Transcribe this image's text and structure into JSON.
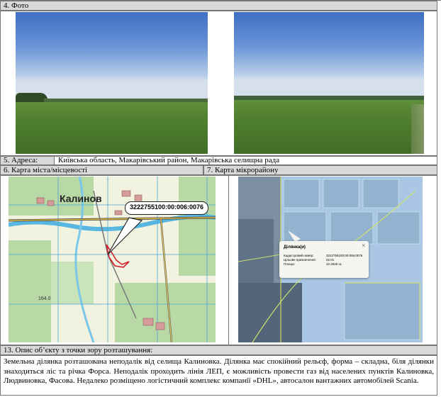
{
  "sections": {
    "photo_header": "4. Фото",
    "address_label": "5. Адреса:",
    "address_value": "Київська область, Макарівський район, Макарівська селищна рада",
    "map_city_header": "6. Карта міста/місцевості",
    "map_micro_header": "7. Карта мікрорайону",
    "description_header": "13. Опис об’єкту з точки зору розташування:"
  },
  "map_city": {
    "town_label": "Калинов",
    "cadastral_callout": "3222755100:00:006:0076",
    "elevation_label": "164.0"
  },
  "map_micro": {
    "popup_title": "Ділянка(и)",
    "popup_rows": [
      {
        "label": "Кадастровий номер:",
        "value": "3222755100:00:006:0076"
      },
      {
        "label": "Цільове призначення:",
        "value": "02.01"
      },
      {
        "label": "Площа:",
        "value": "12.2625 га"
      }
    ]
  },
  "description": "Земельна ділянка розташована неподалік від селища Калиновка. Ділянка має спокійний рельєф, форма – складна, біля ділянки знаходиться ліс та річка Форса. Неподалік проходить лінія ЛЕП, є можливість провести газ від населених пунктів Калиновка, Людвиновка, Фасова. Недалеко розміщено логістичний комплекс компанії «DHL», автосалон вантажних автомобілей Scania."
}
